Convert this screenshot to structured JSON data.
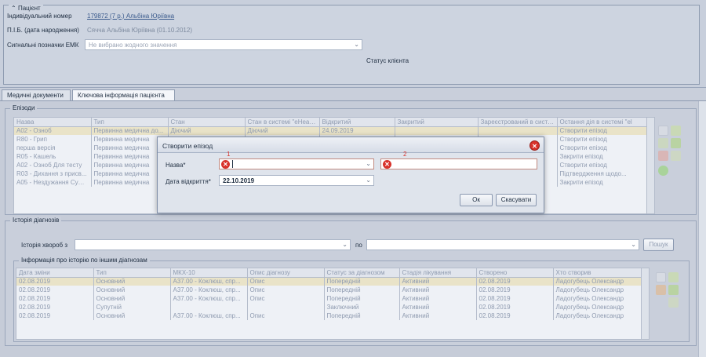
{
  "patient": {
    "legend": "Пацієнт",
    "id_label": "Індивідуальний номер",
    "id_value": "179872 (7 р.) Альбіна Юріївна",
    "name_label": "П.І.Б. (дата народження)",
    "name_value": "Сячча Альбіна Юріївна (01.10.2012)",
    "emk_label": "Сигнальні позначки ЕМК",
    "emk_placeholder": "Не вибрано жодного значення",
    "client_status": "Статус клієнта"
  },
  "tabs": [
    "Медичні документи",
    "Ключова інформація пацієнта"
  ],
  "episodes": {
    "legend": "Епізоди",
    "columns": [
      "Назва",
      "Тип",
      "Стан",
      "Стан в системі \"eHealth\"",
      "Відкритий",
      "Закритий",
      "Зареєстрований в систем",
      "Остання дія в системі \"еl"
    ],
    "rows": [
      [
        "A02 - Озноб",
        "Первинна медична до...",
        "Діючий",
        "Діючий",
        "24.09.2019",
        "",
        "",
        "Створити епізод"
      ],
      [
        "R80 - Грип",
        "Первинна медична",
        "",
        "",
        "",
        "",
        "",
        "Створити епізод"
      ],
      [
        "перша версія",
        "Первинна медична",
        "",
        "",
        "",
        "",
        "",
        "Створити епізод"
      ],
      [
        "R05 - Кашель",
        "Первинна медична",
        "",
        "",
        "",
        "",
        "",
        "Закрити епізод"
      ],
      [
        "A02 - Озноб Для тесту",
        "Первинна медична",
        "",
        "",
        "",
        "",
        "",
        "Створити епізод"
      ],
      [
        "R03 - Дихання з присв...",
        "Первинна медична",
        "",
        "",
        "",
        "",
        "",
        "Підтвердження щодо..."
      ],
      [
        "A05 - Нездужання Суф...",
        "Первинна медична",
        "",
        "",
        "",
        "",
        "",
        "Закрити епізод"
      ]
    ]
  },
  "history": {
    "legend": "Історія діагнозів",
    "from_label": "Історія хвороб з",
    "to_label": "по",
    "search_button": "Пошук",
    "info_legend": "Інформація про історію по іншим діагнозам",
    "columns": [
      "Дата зміни",
      "Тип",
      "МКХ-10",
      "Опис діагнозу",
      "Статус за діагнозом",
      "Стадія лікування",
      "Створено",
      "Хто створив"
    ],
    "rows": [
      [
        "02.08.2019",
        "Основний",
        "А37.00 - Коклюш, спр...",
        "Опис",
        "Попередній",
        "Активний",
        "02.08.2019",
        "Ладогубець Олександр"
      ],
      [
        "02.08.2019",
        "Основний",
        "А37.00 - Коклюш, спр...",
        "Опис",
        "Попередній",
        "Активний",
        "02.08.2019",
        "Ладогубець Олександр"
      ],
      [
        "02.08.2019",
        "Основний",
        "А37.00 - Коклюш, спр...",
        "Опис",
        "Попередній",
        "Активний",
        "02.08.2019",
        "Ладогубець Олександр"
      ],
      [
        "02.08.2019",
        "Супутній",
        "",
        "",
        "Заключний",
        "Активний",
        "02.08.2019",
        "Ладогубець Олександр"
      ],
      [
        "02.08.2019",
        "Основний",
        "А37.00 - Коклюш, спр...",
        "Опис",
        "Попередній",
        "Активний",
        "02.08.2019",
        "Ладогубець Олександр"
      ]
    ]
  },
  "dialog": {
    "title": "Створити епізод",
    "name_label": "Назва*",
    "date_label": "Дата відкриття*",
    "date_value": "22.10.2019",
    "marker1": "1",
    "marker2": "2",
    "ok": "Ок",
    "cancel": "Скасувати"
  },
  "colors": {
    "error": "#d8322b",
    "selected_row": "#e9e3c8",
    "link": "#3a5a8c"
  }
}
